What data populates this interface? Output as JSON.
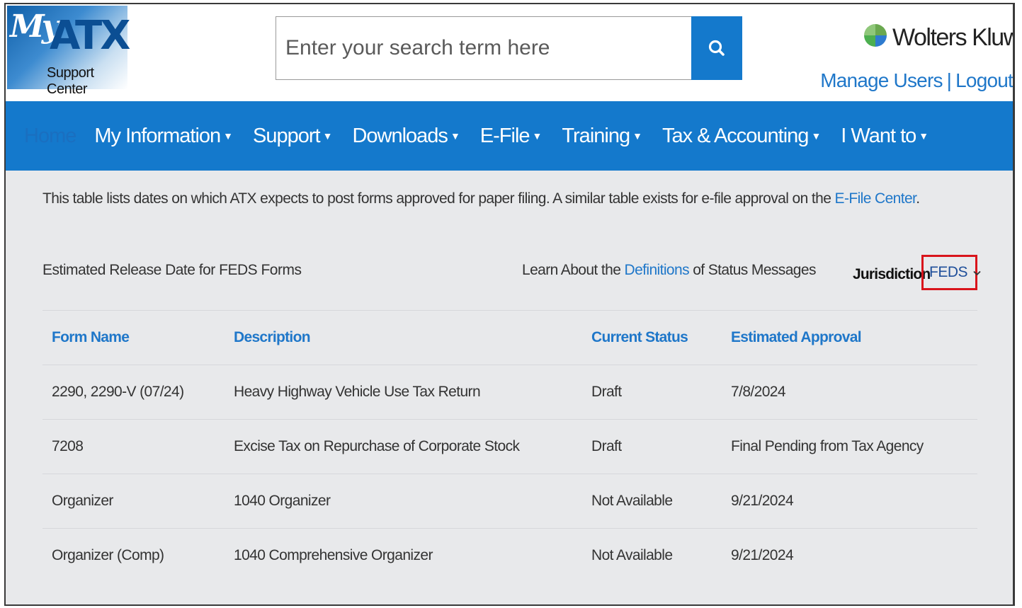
{
  "header": {
    "logo": {
      "my": "My",
      "atx": "ATX",
      "subtitle": "Support Center"
    },
    "search": {
      "placeholder": "Enter your search term here"
    },
    "brand": {
      "name": "Wolters Kluwer"
    },
    "user_links": {
      "manage_users": "Manage Users",
      "separator": "|",
      "logout": "Logout"
    }
  },
  "nav": {
    "home": "Home",
    "items": [
      {
        "label": "My Information"
      },
      {
        "label": "Support"
      },
      {
        "label": "Downloads"
      },
      {
        "label": "E-File"
      },
      {
        "label": "Training"
      },
      {
        "label": "Tax & Accounting"
      },
      {
        "label": "I Want to"
      }
    ],
    "caret": "▼"
  },
  "intro": {
    "text": "This table lists dates on which ATX expects to post forms approved for paper filing. A similar table exists for e-file approval on the ",
    "link": "E-File Center",
    "suffix": "."
  },
  "section": {
    "title": "Estimated Release Date for FEDS Forms",
    "learn_prefix": "Learn About the ",
    "learn_link": "Definitions",
    "learn_suffix": " of Status Messages",
    "jurisdiction_label": "Jurisdiction",
    "jurisdiction_value": "FEDS"
  },
  "table": {
    "headers": [
      "Form Name",
      "Description",
      "Current Status",
      "Estimated Approval"
    ],
    "rows": [
      [
        "2290, 2290-V (07/24)",
        "Heavy Highway Vehicle Use Tax Return",
        "Draft",
        "7/8/2024"
      ],
      [
        "7208",
        "Excise Tax on Repurchase of Corporate Stock",
        "Draft",
        "Final Pending from Tax Agency"
      ],
      [
        "Organizer",
        "1040 Organizer",
        "Not Available",
        "9/21/2024"
      ],
      [
        "Organizer (Comp)",
        "1040 Comprehensive Organizer",
        "Not Available",
        "9/21/2024"
      ]
    ]
  },
  "colors": {
    "nav_bg": "#1479cc",
    "link": "#1f77c9",
    "highlight_border": "#d9141b",
    "page_bg": "#e8e9eb"
  },
  "icons": {
    "search": "search-icon",
    "brand": "wolters-kluwer-globe-icon",
    "dropdown": "chevron-down-icon"
  }
}
